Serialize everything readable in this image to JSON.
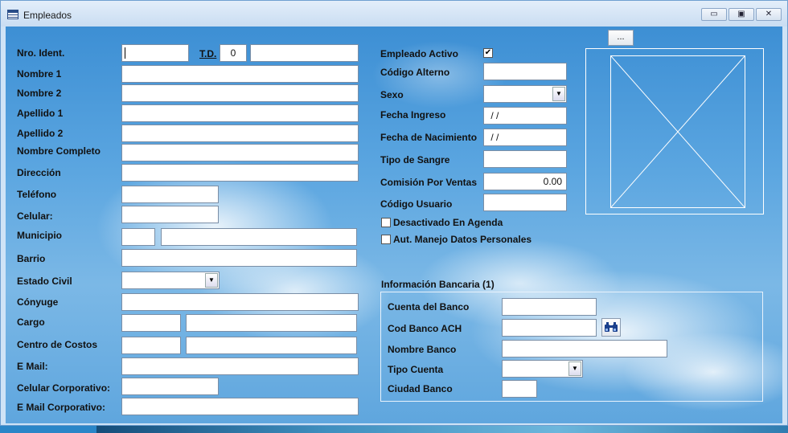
{
  "window": {
    "title": "Empleados",
    "buttons": {
      "minimize": "▭",
      "maximize": "▣",
      "close": "✕"
    },
    "icon": "table-icon"
  },
  "left": {
    "nro_ident": {
      "label": "Nro. Ident.",
      "value": ""
    },
    "td": {
      "label": "T.D.",
      "code": "0",
      "desc": ""
    },
    "nombre1": {
      "label": "Nombre 1",
      "value": ""
    },
    "nombre2": {
      "label": "Nombre 2",
      "value": ""
    },
    "apellido1": {
      "label": "Apellido 1",
      "value": ""
    },
    "apellido2": {
      "label": "Apellido 2",
      "value": ""
    },
    "nombre_completo": {
      "label": "Nombre Completo",
      "value": ""
    },
    "direccion": {
      "label": "Dirección",
      "value": ""
    },
    "telefono": {
      "label": "Teléfono",
      "value": ""
    },
    "celular": {
      "label": "Celular:",
      "value": ""
    },
    "municipio": {
      "label": "Municipio",
      "code": "",
      "name": ""
    },
    "barrio": {
      "label": "Barrio",
      "value": ""
    },
    "estado_civil": {
      "label": "Estado Civil",
      "value": ""
    },
    "conyuge": {
      "label": "Cónyuge",
      "value": ""
    },
    "cargo": {
      "label": "Cargo",
      "code": "",
      "name": ""
    },
    "centro_costos": {
      "label": "Centro de Costos",
      "code": "",
      "name": ""
    },
    "email": {
      "label": "E Mail:",
      "value": ""
    },
    "celular_corporativo": {
      "label": "Celular Corporativo:",
      "value": ""
    },
    "email_corporativo": {
      "label": "E Mail Corporativo:",
      "value": ""
    }
  },
  "right": {
    "empleado_activo": {
      "label": "Empleado Activo",
      "checked": true,
      "mark": "✔"
    },
    "codigo_alterno": {
      "label": "Código Alterno",
      "value": ""
    },
    "sexo": {
      "label": "Sexo",
      "value": ""
    },
    "fecha_ingreso": {
      "label": "Fecha Ingreso",
      "value": " / /"
    },
    "fecha_nacimiento": {
      "label": "Fecha de Nacimiento",
      "value": " / /"
    },
    "tipo_sangre": {
      "label": "Tipo de Sangre",
      "value": ""
    },
    "comision_ventas": {
      "label": "Comisión Por Ventas",
      "value": "0.00"
    },
    "codigo_usuario": {
      "label": "Código Usuario",
      "value": ""
    },
    "desactivado_agenda": {
      "label": "Desactivado En Agenda",
      "checked": false
    },
    "aut_manejo_datos": {
      "label": "Aut. Manejo Datos Personales",
      "checked": false
    },
    "browse_button": "..."
  },
  "banco": {
    "title": "Información Bancaria (1)",
    "cuenta": {
      "label": "Cuenta del Banco",
      "value": ""
    },
    "cod_ach": {
      "label": "Cod Banco ACH",
      "value": "",
      "search_icon": "binoculars-icon"
    },
    "nombre": {
      "label": "Nombre Banco",
      "value": ""
    },
    "tipo_cuenta": {
      "label": "Tipo Cuenta",
      "value": ""
    },
    "ciudad": {
      "label": "Ciudad Banco",
      "value": ""
    }
  },
  "colors": {
    "window_border": "#6f9fd0",
    "titlebar": "#d6e6f7",
    "binoculars": "#1a3f8c"
  }
}
